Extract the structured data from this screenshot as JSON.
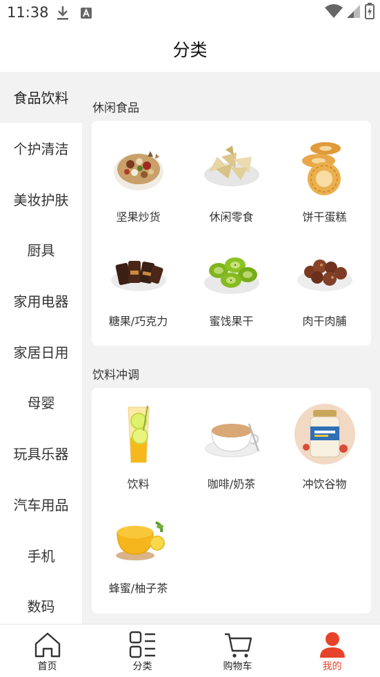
{
  "status_bar": {
    "time": "11:38",
    "left_icons": [
      "download-icon",
      "font-a-icon"
    ],
    "right_icons": [
      "wifi-icon",
      "cellular-signal-icon",
      "battery-charging-icon"
    ]
  },
  "header": {
    "title": "分类"
  },
  "sidebar": {
    "items": [
      {
        "label": "食品饮料",
        "active": true
      },
      {
        "label": "个护清洁"
      },
      {
        "label": "美妆护肤"
      },
      {
        "label": "厨具"
      },
      {
        "label": "家用电器"
      },
      {
        "label": "家居日用"
      },
      {
        "label": "母婴"
      },
      {
        "label": "玩具乐器"
      },
      {
        "label": "汽车用品"
      },
      {
        "label": "手机"
      },
      {
        "label": "数码"
      }
    ]
  },
  "sections": [
    {
      "title": "休闲食品",
      "items": [
        {
          "label": "坚果炒货",
          "icon": "nuts-image"
        },
        {
          "label": "休闲零食",
          "icon": "snack-chips-image"
        },
        {
          "label": "饼干蛋糕",
          "icon": "cookies-image"
        },
        {
          "label": "糖果/巧克力",
          "icon": "chocolate-bars-image"
        },
        {
          "label": "蜜饯果干",
          "icon": "dried-kiwi-image"
        },
        {
          "label": "肉干肉脯",
          "icon": "meat-jerky-image"
        }
      ]
    },
    {
      "title": "饮料冲调",
      "items": [
        {
          "label": "饮料",
          "icon": "lemon-drink-image"
        },
        {
          "label": "咖啡/奶茶",
          "icon": "milk-tea-cup-image"
        },
        {
          "label": "冲饮谷物",
          "icon": "oatmeal-jar-image"
        },
        {
          "label": "蜂蜜/柚子茶",
          "icon": "honey-citron-tea-image"
        }
      ]
    }
  ],
  "tabbar": {
    "tabs": [
      {
        "label": "首页",
        "icon": "home-icon"
      },
      {
        "label": "分类",
        "icon": "category-grid-icon"
      },
      {
        "label": "购物车",
        "icon": "shopping-cart-icon"
      },
      {
        "label": "我的",
        "icon": "user-profile-icon",
        "active": true
      }
    ]
  },
  "colors": {
    "accent": "#e8432a",
    "background": "#f2f2f2",
    "card": "#ffffff",
    "text": "#333333"
  }
}
